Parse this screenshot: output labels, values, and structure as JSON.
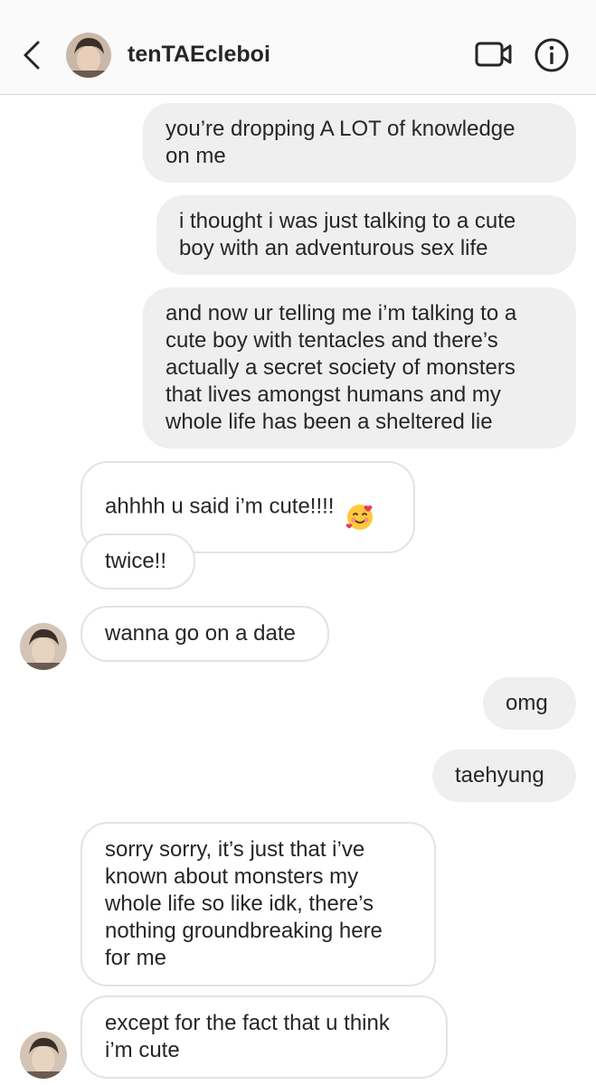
{
  "header": {
    "username": "tenTAEcleboi",
    "back_icon": "chevron-left-icon",
    "video_icon": "video-camera-icon",
    "info_icon": "info-icon"
  },
  "messages": [
    {
      "side": "sent",
      "text": "you’re dropping A LOT of knowledge\non me"
    },
    {
      "side": "sent",
      "text": "i thought i was just talking to a cute\nboy with an adventurous sex life"
    },
    {
      "side": "sent",
      "text": "and now ur telling me i’m talking to a\ncute boy with tentacles and there’s\nactually a secret society of monsters\nthat lives amongst humans and my\nwhole life has been a sheltered lie"
    },
    {
      "side": "received",
      "text": "ahhhh u said i’m cute!!!!",
      "emoji": "smiling-face-with-hearts-icon"
    },
    {
      "side": "received",
      "text": "twice!!"
    },
    {
      "side": "received",
      "text": "wanna go on a date"
    },
    {
      "side": "sent",
      "text": "omg"
    },
    {
      "side": "sent",
      "text": "taehyung"
    },
    {
      "side": "received",
      "text": "sorry sorry, it’s just that i’ve\nknown about monsters my\nwhole life so like idk, there’s\nnothing groundbreaking here\nfor me"
    },
    {
      "side": "received",
      "text": "except for the fact that u think\ni’m cute"
    }
  ],
  "colors": {
    "sent_bubble": "#efefef",
    "received_border": "#e3e3e3",
    "header_bg": "#fafafa",
    "text": "#262626"
  }
}
